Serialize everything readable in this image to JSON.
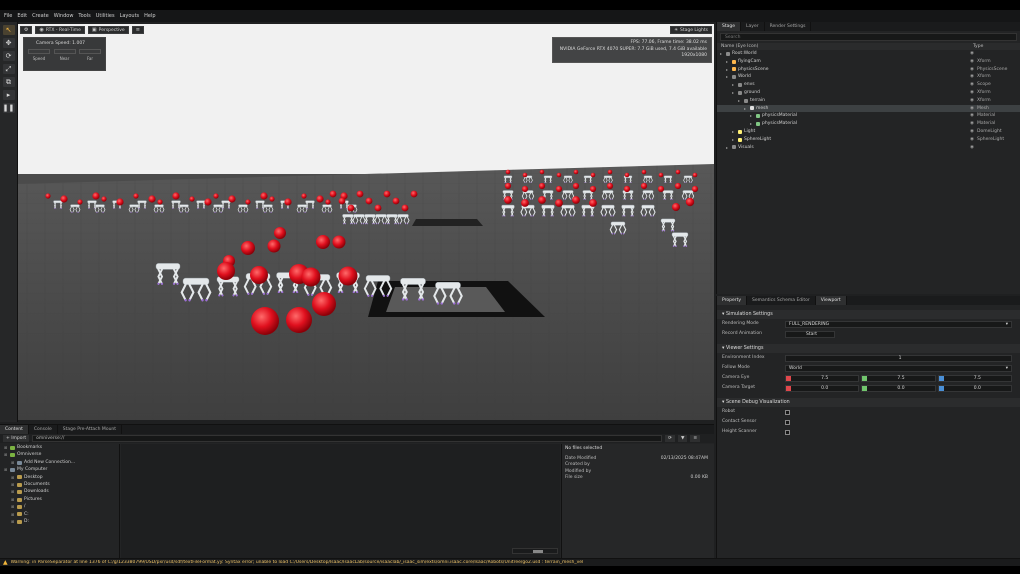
{
  "menu": [
    "File",
    "Edit",
    "Create",
    "Window",
    "Tools",
    "Utilities",
    "Layouts",
    "Help"
  ],
  "colors": {
    "accent": "#f1b442",
    "sphere": "#e0101e",
    "robot": "#e4e8ea",
    "floor": "#4b4b4b",
    "sky": "#f1f1f1",
    "warning": "#f2c66a"
  },
  "toolbar": {
    "tools": [
      {
        "name": "select-icon",
        "glyph": "↖"
      },
      {
        "name": "move-icon",
        "glyph": "✥"
      },
      {
        "name": "rotate-icon",
        "glyph": "⟳"
      },
      {
        "name": "scale-icon",
        "glyph": "⤢"
      },
      {
        "name": "snap-icon",
        "glyph": "⧉"
      },
      {
        "name": "play-icon",
        "glyph": "▸"
      },
      {
        "name": "pause-icon",
        "glyph": "❚❚"
      }
    ]
  },
  "viewport": {
    "buttons": {
      "render_mode": "RTX - Real-Time",
      "camera": "Perspective"
    },
    "stage_lights": "Stage Lights",
    "camera_speed": {
      "title": "Camera Speed:",
      "value": "1.007",
      "labels": [
        "Speed",
        "Near",
        "Far"
      ]
    },
    "stats": {
      "fps": "FPS: 77.06, Frame time: 38.02 ms",
      "gpu": "NVIDIA GeForce RTX 4070 SUPER: 7.7 GiB used, 7.4 GiB available",
      "resolution": "1920x1080"
    }
  },
  "stage": {
    "tabs": [
      "Stage",
      "Layer",
      "Render Settings"
    ],
    "search_placeholder": "Search",
    "columns": {
      "name": "Name (Eye Icon)",
      "type": "Type"
    },
    "rows": [
      {
        "name": "Root:World",
        "type": "",
        "depth": 0,
        "icon": "#8a8a8a"
      },
      {
        "name": "flyingCam",
        "type": "Xform",
        "depth": 1,
        "icon": "#ffb74d"
      },
      {
        "name": "physicsScene",
        "type": "PhysicsScene",
        "depth": 1,
        "icon": "#ffb74d"
      },
      {
        "name": "World",
        "type": "Xform",
        "depth": 1,
        "icon": "#8a8a8a"
      },
      {
        "name": "envs",
        "type": "Scope",
        "depth": 2,
        "icon": "#8a8a8a"
      },
      {
        "name": "ground",
        "type": "Xform",
        "depth": 2,
        "icon": "#8a8a8a"
      },
      {
        "name": "terrain",
        "type": "Xform",
        "depth": 3,
        "icon": "#8a8a8a"
      },
      {
        "name": "mesh",
        "type": "Mesh",
        "depth": 4,
        "icon": "#e0e0e0",
        "selected": true
      },
      {
        "name": "physicsMaterial",
        "type": "Material",
        "depth": 5,
        "icon": "#81c784"
      },
      {
        "name": "physicsMaterial",
        "type": "Material",
        "depth": 5,
        "icon": "#81c784"
      },
      {
        "name": "Light",
        "type": "DomeLight",
        "depth": 2,
        "icon": "#fff176"
      },
      {
        "name": "SphereLight",
        "type": "SphereLight",
        "depth": 2,
        "icon": "#fff176"
      },
      {
        "name": "Visuals",
        "type": "",
        "depth": 1,
        "icon": "#8a8a8a"
      }
    ]
  },
  "properties": {
    "tabs": [
      "Property",
      "Semantics Schema Editor",
      "Viewport"
    ],
    "simulation_section": "Simulation Settings",
    "rendering_mode_label": "Rendering Mode",
    "rendering_mode_value": "FULL_RENDERING",
    "record_label": "Record Animation",
    "record_button": "Start",
    "viewer_section": "Viewer Settings",
    "env_index_label": "Environment Index",
    "env_index_value": "1",
    "follow_mode_label": "Follow Mode",
    "follow_mode_value": "World",
    "camera_eye_label": "Camera Eye",
    "camera_eye": [
      "7.5",
      "7.5",
      "7.5"
    ],
    "camera_target_label": "Camera Target",
    "camera_target": [
      "0.0",
      "0.0",
      "0.0"
    ],
    "debug_section": "Scene Debug Visualization",
    "debug_rows": [
      "Robot",
      "Contact Sensor",
      "Height Scanner"
    ]
  },
  "content": {
    "tabs": [
      "Content",
      "Console",
      "Stage Pre-Attach Mount"
    ],
    "import_button": "Import",
    "path": "omniverse://",
    "tree": [
      {
        "name": "Bookmarks",
        "depth": 0,
        "kind": "g"
      },
      {
        "name": "Omniverse",
        "depth": 0,
        "kind": "g"
      },
      {
        "name": "Add New Connection...",
        "depth": 1,
        "kind": "b"
      },
      {
        "name": "My Computer",
        "depth": 0,
        "kind": "b"
      },
      {
        "name": "Desktop",
        "depth": 1,
        "kind": "y"
      },
      {
        "name": "Documents",
        "depth": 1,
        "kind": "y"
      },
      {
        "name": "Downloads",
        "depth": 1,
        "kind": "y"
      },
      {
        "name": "Pictures",
        "depth": 1,
        "kind": "y"
      },
      {
        "name": "/",
        "depth": 1,
        "kind": "y"
      },
      {
        "name": "C:",
        "depth": 1,
        "kind": "y"
      },
      {
        "name": "D:",
        "depth": 1,
        "kind": "y"
      }
    ],
    "details_title": "No files selected",
    "details": [
      {
        "k": "Date Modified",
        "v": "02/13/2025 08:47AM"
      },
      {
        "k": "Created by",
        "v": ""
      },
      {
        "k": "Modified by",
        "v": ""
      },
      {
        "k": "File size",
        "v": "0.00 KB"
      }
    ]
  },
  "status": {
    "message": "Warning: in ParseSeparator at line 1376 of C:/g/123380799/USD/pxr/usd/sdf/textFileFormat.yy: Syntax error; unable to load C:/Users/Desktop/Isaac/IsaacLab/source/isaaclab/_isaac_sim/exts/omni.isaac.core/Isaac/Robots/Unitree/go2.usd : terrain_mesh_vel"
  }
}
